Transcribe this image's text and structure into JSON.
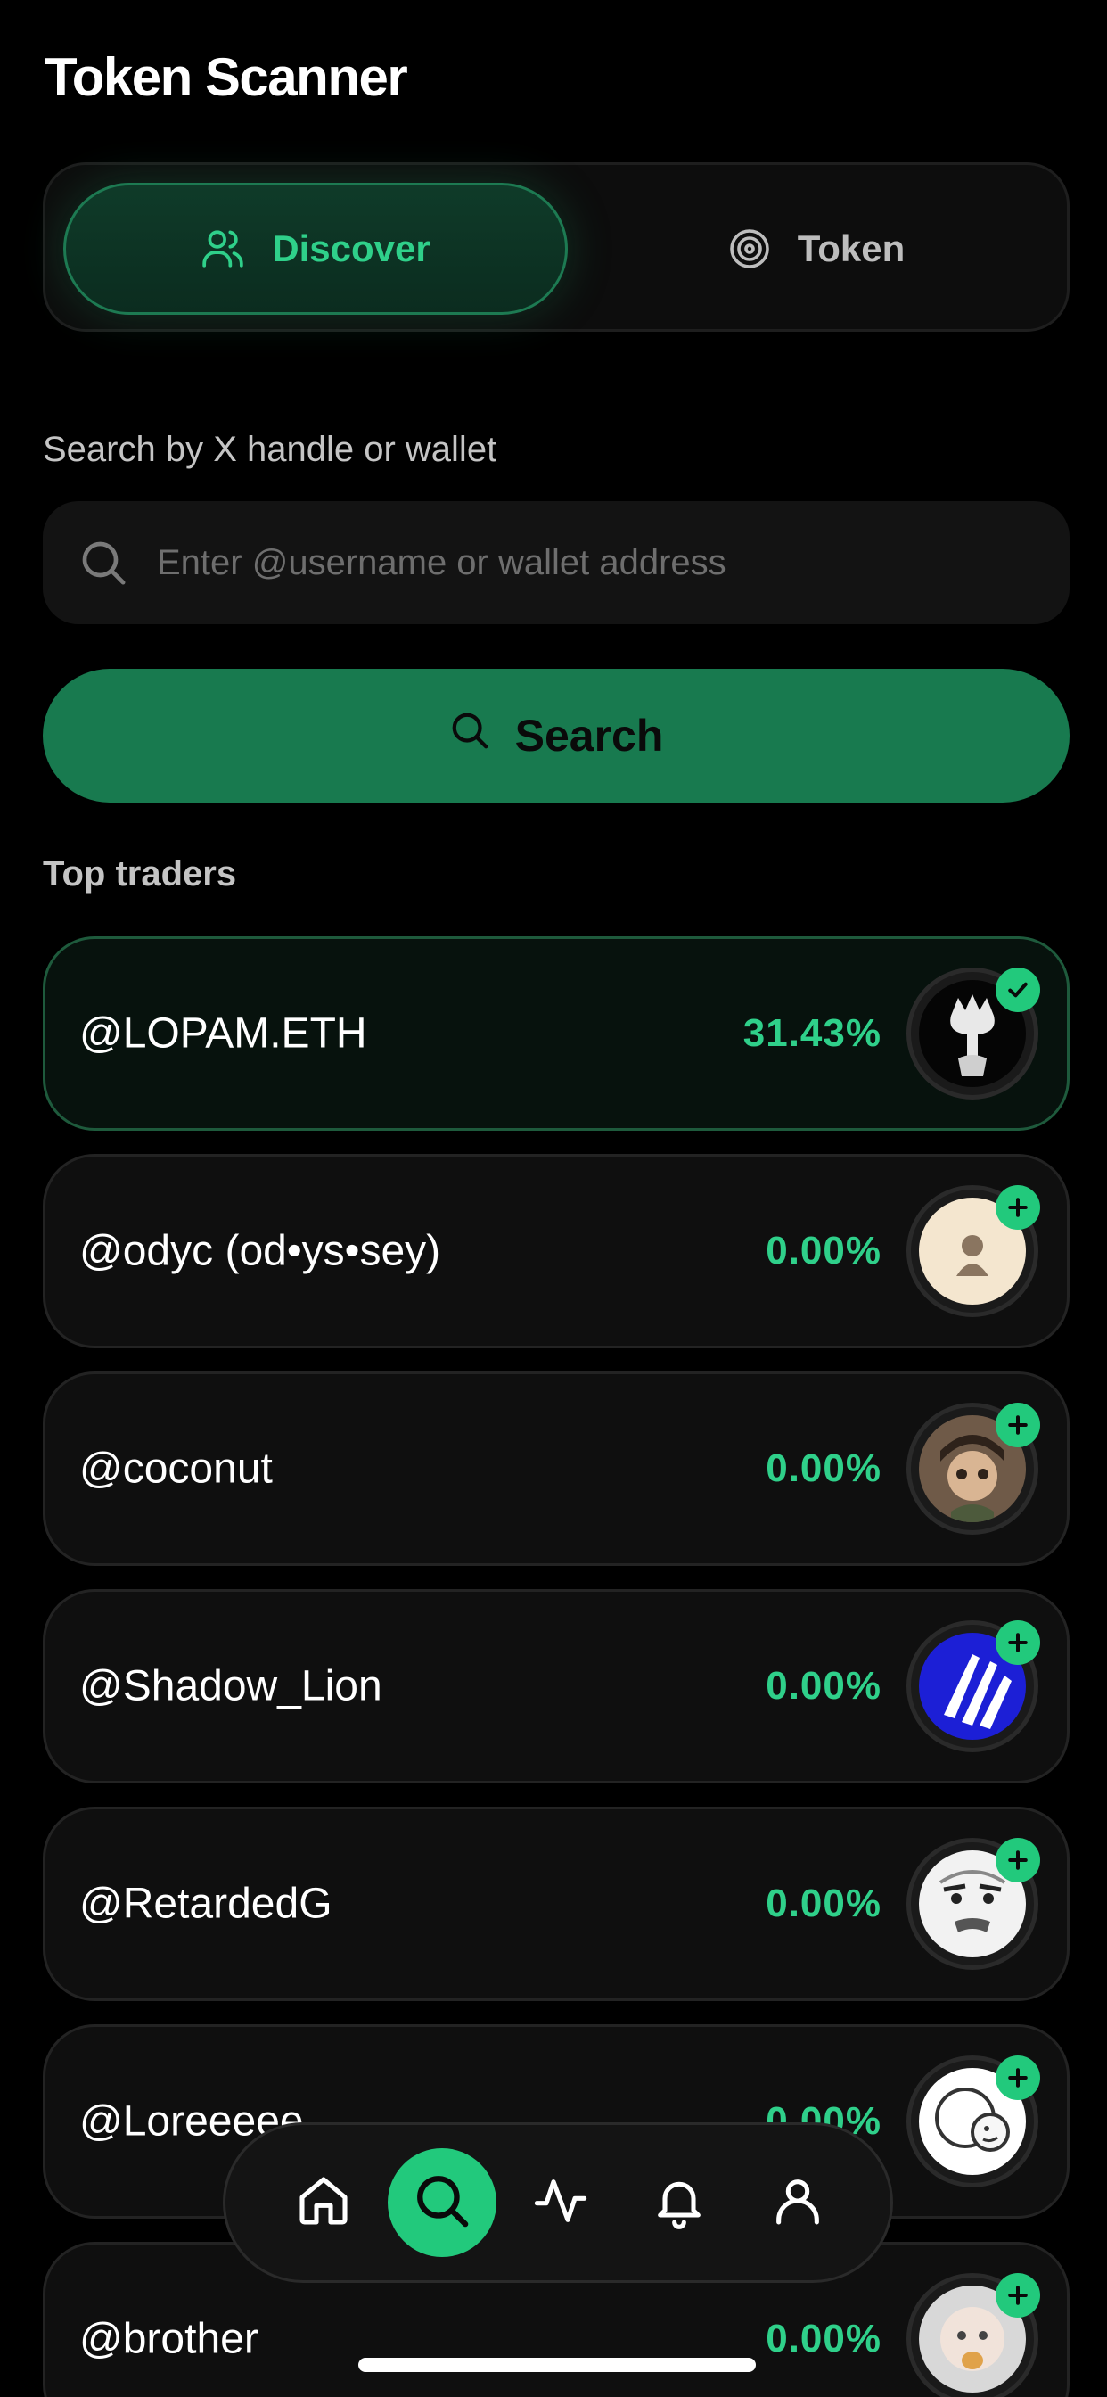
{
  "header": {
    "title": "Token Scanner"
  },
  "tabs": [
    {
      "label": "Discover",
      "icon": "users-icon",
      "active": true
    },
    {
      "label": "Token",
      "icon": "target-icon",
      "active": false
    }
  ],
  "search": {
    "label": "Search by X handle or wallet",
    "placeholder": "Enter @username or wallet address",
    "value": "",
    "button_label": "Search"
  },
  "top_traders": {
    "label": "Top traders",
    "items": [
      {
        "handle": "@LOPAM.ETH",
        "pct": "31.43%",
        "badge": "check",
        "selected": true
      },
      {
        "handle": "@odyc (od•ys•sey)",
        "pct": "0.00%",
        "badge": "plus",
        "selected": false
      },
      {
        "handle": "@coconut",
        "pct": "0.00%",
        "badge": "plus",
        "selected": false
      },
      {
        "handle": "@Shadow_Lion",
        "pct": "0.00%",
        "badge": "plus",
        "selected": false
      },
      {
        "handle": "@RetardedG",
        "pct": "0.00%",
        "badge": "plus",
        "selected": false
      },
      {
        "handle": "@Loreeeee",
        "pct": "0.00%",
        "badge": "plus",
        "selected": false
      },
      {
        "handle": "@brother",
        "pct": "0.00%",
        "badge": "plus",
        "selected": false
      }
    ]
  },
  "bottom_nav": {
    "items": [
      {
        "icon": "home-icon",
        "active": false
      },
      {
        "icon": "search-icon",
        "active": true
      },
      {
        "icon": "activity-icon",
        "active": false
      },
      {
        "icon": "bell-icon",
        "active": false
      },
      {
        "icon": "user-icon",
        "active": false
      }
    ]
  },
  "colors": {
    "background": "#000000",
    "accent": "#22c97c",
    "accent_text": "#2fd08a",
    "search_button": "#187a4f",
    "card": "#0f0f0f"
  }
}
